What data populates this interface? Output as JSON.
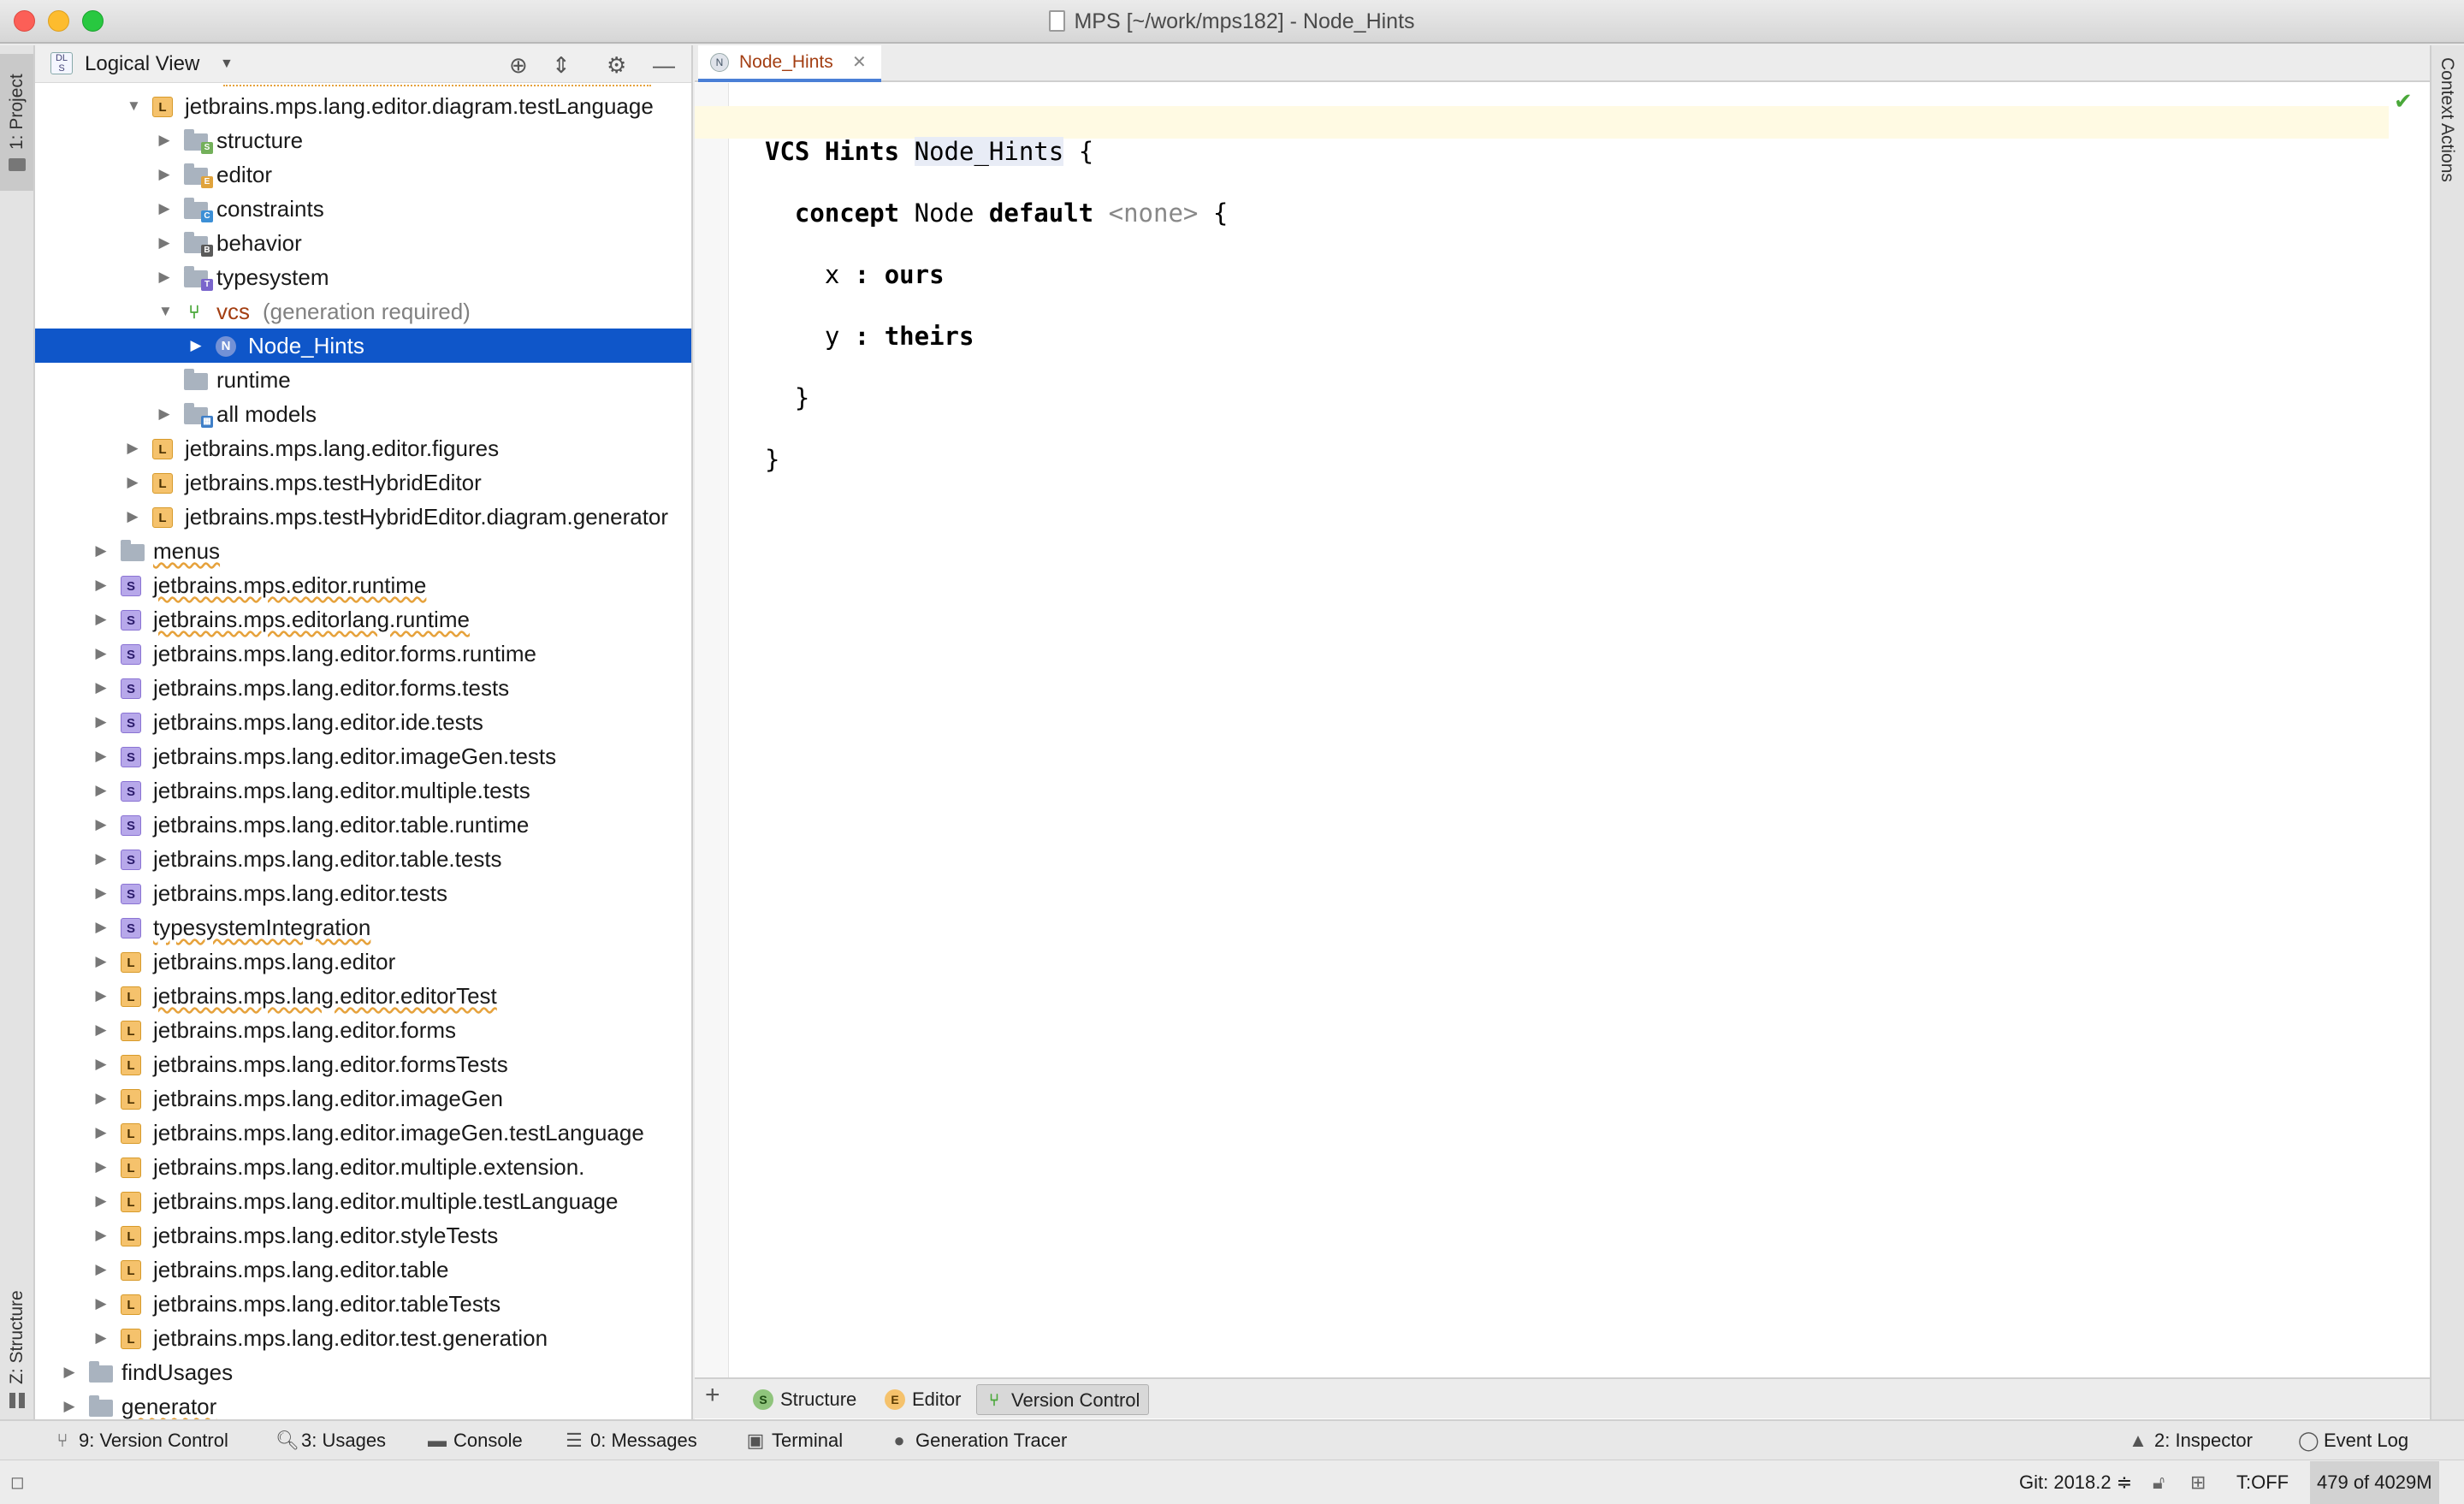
{
  "window": {
    "title": "MPS [~/work/mps182] - Node_Hints"
  },
  "side_strips": {
    "left_top": "1: Project",
    "left_bottom": "Z: Structure",
    "right": "Context Actions"
  },
  "project_panel": {
    "view_selector": "Logical View"
  },
  "tree": [
    {
      "label": "jetbrains.mps.lang.editor.diagram.testLanguage",
      "icon": "L",
      "depth": 2,
      "arrow": "▼",
      "wavy": false
    },
    {
      "label": "structure",
      "icon": "folder",
      "badge": "S",
      "depth": 3,
      "arrow": "▶"
    },
    {
      "label": "editor",
      "icon": "folder",
      "badge": "E",
      "depth": 3,
      "arrow": "▶"
    },
    {
      "label": "constraints",
      "icon": "folder",
      "badge": "C",
      "depth": 3,
      "arrow": "▶"
    },
    {
      "label": "behavior",
      "icon": "folder",
      "badge": "B",
      "depth": 3,
      "arrow": "▶"
    },
    {
      "label": "typesystem",
      "icon": "folder",
      "badge": "T",
      "depth": 3,
      "arrow": "▶"
    },
    {
      "label": "vcs",
      "hint": "(generation required)",
      "icon": "vcs",
      "depth": 3,
      "arrow": "▼"
    },
    {
      "label": "Node_Hints",
      "icon": "N",
      "depth": 4,
      "arrow": "▶",
      "selected": true
    },
    {
      "label": "runtime",
      "icon": "folder",
      "depth": 3,
      "arrow": ""
    },
    {
      "label": "all models",
      "icon": "folder",
      "badge": "grid",
      "depth": 3,
      "arrow": "▶"
    },
    {
      "label": "jetbrains.mps.lang.editor.figures",
      "icon": "L",
      "depth": 2,
      "arrow": "▶"
    },
    {
      "label": "jetbrains.mps.testHybridEditor",
      "icon": "L",
      "depth": 2,
      "arrow": "▶"
    },
    {
      "label": "jetbrains.mps.testHybridEditor.diagram.generator",
      "icon": "L",
      "depth": 2,
      "arrow": "▶"
    },
    {
      "label": "menus",
      "icon": "folder",
      "depth": 1,
      "arrow": "▶",
      "wavy": true
    },
    {
      "label": "jetbrains.mps.editor.runtime",
      "icon": "S",
      "depth": 1,
      "arrow": "▶",
      "wavy": true
    },
    {
      "label": "jetbrains.mps.editorlang.runtime",
      "icon": "S",
      "depth": 1,
      "arrow": "▶",
      "wavy": true
    },
    {
      "label": "jetbrains.mps.lang.editor.forms.runtime",
      "icon": "S",
      "depth": 1,
      "arrow": "▶"
    },
    {
      "label": "jetbrains.mps.lang.editor.forms.tests",
      "icon": "S",
      "depth": 1,
      "arrow": "▶"
    },
    {
      "label": "jetbrains.mps.lang.editor.ide.tests",
      "icon": "S",
      "depth": 1,
      "arrow": "▶"
    },
    {
      "label": "jetbrains.mps.lang.editor.imageGen.tests",
      "icon": "S",
      "depth": 1,
      "arrow": "▶"
    },
    {
      "label": "jetbrains.mps.lang.editor.multiple.tests",
      "icon": "S",
      "depth": 1,
      "arrow": "▶"
    },
    {
      "label": "jetbrains.mps.lang.editor.table.runtime",
      "icon": "S",
      "depth": 1,
      "arrow": "▶"
    },
    {
      "label": "jetbrains.mps.lang.editor.table.tests",
      "icon": "S",
      "depth": 1,
      "arrow": "▶"
    },
    {
      "label": "jetbrains.mps.lang.editor.tests",
      "icon": "S",
      "depth": 1,
      "arrow": "▶"
    },
    {
      "label": "typesystemIntegration",
      "icon": "S",
      "depth": 1,
      "arrow": "▶",
      "wavy": true
    },
    {
      "label": "jetbrains.mps.lang.editor",
      "icon": "L",
      "depth": 1,
      "arrow": "▶"
    },
    {
      "label": "jetbrains.mps.lang.editor.editorTest",
      "icon": "L",
      "depth": 1,
      "arrow": "▶",
      "wavy": true
    },
    {
      "label": "jetbrains.mps.lang.editor.forms",
      "icon": "L",
      "depth": 1,
      "arrow": "▶"
    },
    {
      "label": "jetbrains.mps.lang.editor.formsTests",
      "icon": "L",
      "depth": 1,
      "arrow": "▶"
    },
    {
      "label": "jetbrains.mps.lang.editor.imageGen",
      "icon": "L",
      "depth": 1,
      "arrow": "▶"
    },
    {
      "label": "jetbrains.mps.lang.editor.imageGen.testLanguage",
      "icon": "L",
      "depth": 1,
      "arrow": "▶"
    },
    {
      "label": "jetbrains.mps.lang.editor.multiple.extension.",
      "icon": "L",
      "depth": 1,
      "arrow": "▶"
    },
    {
      "label": "jetbrains.mps.lang.editor.multiple.testLanguage",
      "icon": "L",
      "depth": 1,
      "arrow": "▶"
    },
    {
      "label": "jetbrains.mps.lang.editor.styleTests",
      "icon": "L",
      "depth": 1,
      "arrow": "▶"
    },
    {
      "label": "jetbrains.mps.lang.editor.table",
      "icon": "L",
      "depth": 1,
      "arrow": "▶"
    },
    {
      "label": "jetbrains.mps.lang.editor.tableTests",
      "icon": "L",
      "depth": 1,
      "arrow": "▶"
    },
    {
      "label": "jetbrains.mps.lang.editor.test.generation",
      "icon": "L",
      "depth": 1,
      "arrow": "▶"
    },
    {
      "label": "findUsages",
      "icon": "folder",
      "depth": 0,
      "arrow": "▶"
    },
    {
      "label": "generator",
      "icon": "folder",
      "depth": 0,
      "arrow": "▶",
      "wavy": true
    }
  ],
  "editor": {
    "tab_label": "Node_Hints",
    "tab_icon": "N",
    "code": {
      "l1_kw": "VCS Hints",
      "l1_name": "Node_Hints",
      "l1_brace": "{",
      "l2_kw": "concept",
      "l2_name": "Node",
      "l2_kw2": "default",
      "l2_none": "<none>",
      "l2_brace": "{",
      "l3_prop": "x",
      "l3_colon": ":",
      "l3_val": "ours",
      "l4_prop": "y",
      "l4_colon": ":",
      "l4_val": "theirs",
      "l5_brace": "}",
      "l6_brace": "}"
    },
    "bottom_tabs": {
      "add": "+",
      "structure": "Structure",
      "editor": "Editor",
      "version_control": "Version Control"
    }
  },
  "tool_windows": {
    "version_control": "9: Version Control",
    "usages": "3: Usages",
    "console": "Console",
    "messages": "0: Messages",
    "terminal": "Terminal",
    "generation_tracer": "Generation Tracer",
    "inspector": "2: Inspector",
    "event_log": "Event Log"
  },
  "status": {
    "git": "Git: 2018.2 ≑",
    "typing": "T:OFF",
    "memory": "479 of 4029M"
  },
  "colors": {
    "selection": "#0f56c9",
    "accent_tab": "#4a7fd6",
    "check": "#4aa83a"
  }
}
